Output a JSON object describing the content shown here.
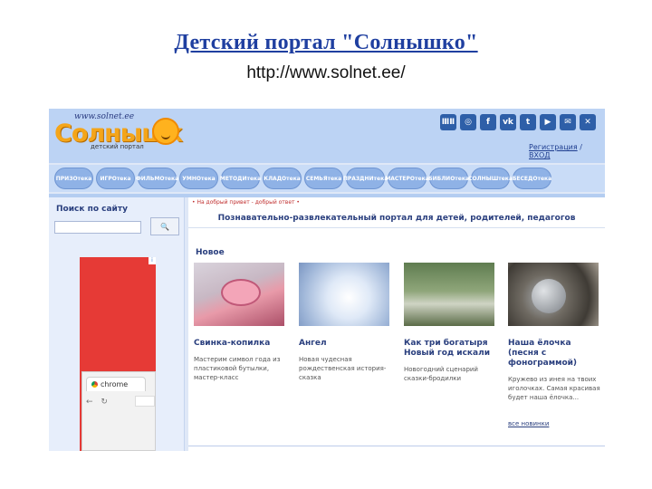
{
  "slide": {
    "title": "Детский портал \"Солнышко\"",
    "url": "http://www.solnet.ee/"
  },
  "site": {
    "logo_url": "www.solnet.ee",
    "logo_word": "Солнышк",
    "logo_sub": "детский портал",
    "socials": [
      "ⅢⅡ",
      "◎",
      "f",
      "vk",
      "t",
      "▶",
      "✉",
      "✕"
    ],
    "auth": {
      "register": "Регистрация",
      "sep": " / ",
      "login": "ВХОД"
    },
    "nav": [
      "ПРИЗОтека",
      "ИГРОтека",
      "ФИЛЬМОтека",
      "УМНОтека",
      "МЕТОДИтека",
      "КЛАДОтека",
      "СЕМЬЯтека",
      "ПРАЗДНИтека",
      "МАСТЕРОтека",
      "БИБЛИОтека",
      "СОЛНЫШтека",
      "БЕСЕДОтека"
    ],
    "search": {
      "label": "Поиск по сайту",
      "button": "🔍"
    },
    "chrome_ad": {
      "tab": "chrome",
      "nav": "← ↻"
    },
    "breadcrumb": "• На добрый привет - добрый ответ •",
    "tagline": "Познавательно-развлекательный портал для детей, родителей, педагогов",
    "new_heading": "Новое",
    "articles": [
      {
        "title": "Свинка-копилка",
        "desc": "Мастерим символ года из пластиковой бутылки, мастер-класс"
      },
      {
        "title": "Ангел",
        "desc": "Новая чудесная рождественская история-сказка"
      },
      {
        "title": "Как три богатыря Новый год искали",
        "desc": "Новогодний сценарий сказки-бродилки"
      },
      {
        "title": "Наша ёлочка (песня с фонограммой)",
        "desc": "Кружево из инея на твоих иголочках. Самая красивая будет наша ёлочка..."
      }
    ],
    "more_link": "все новинки"
  }
}
